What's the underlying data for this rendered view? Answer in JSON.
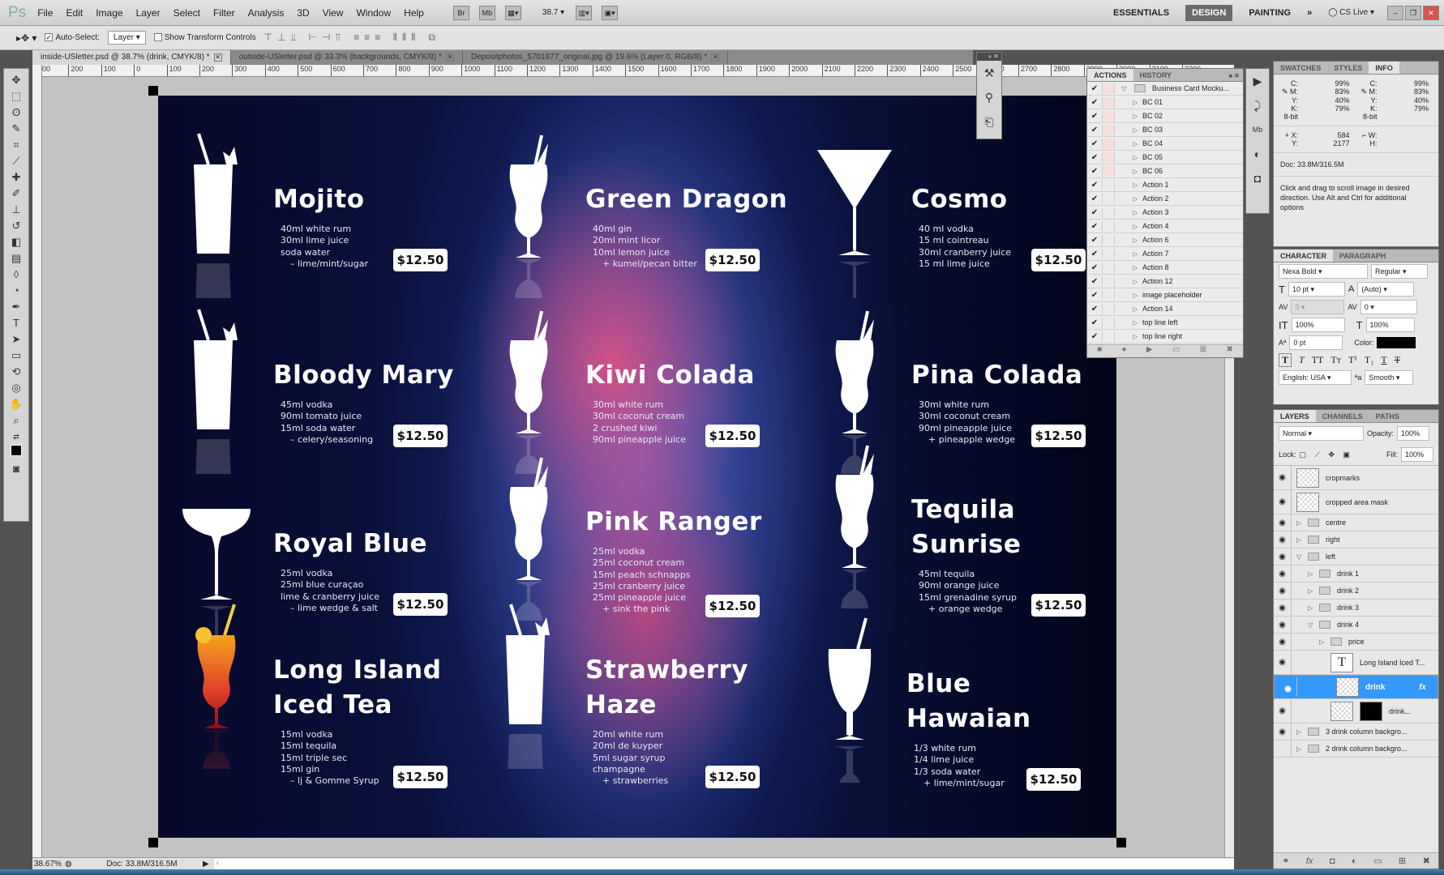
{
  "app": {
    "logo": "Ps",
    "menu": [
      "File",
      "Edit",
      "Image",
      "Layer",
      "Select",
      "Filter",
      "Analysis",
      "3D",
      "View",
      "Window",
      "Help"
    ],
    "bridge": "Br",
    "minibridge": "Mb",
    "zoom_select": "38.7",
    "workspaces": [
      "ESSENTIALS",
      "DESIGN",
      "PAINTING"
    ],
    "active_workspace": "DESIGN",
    "more": "»",
    "cs_live": "CS Live"
  },
  "options": {
    "auto_select_label": "Auto-Select:",
    "auto_select_checked": true,
    "auto_select_value": "Layer",
    "transform_label": "Show Transform Controls",
    "transform_checked": false
  },
  "tabs": [
    {
      "label": "inside-USletter.psd @ 38.7% (drink, CMYK/8) *",
      "active": true
    },
    {
      "label": "outside-USletter.psd @ 33.3% (backgrounds, CMYK/8) *",
      "active": false
    },
    {
      "label": "Depositphotos_5701877_original.jpg @ 19.6% (Layer 0, RGB/8) *",
      "active": false
    }
  ],
  "ruler": [
    "300",
    "200",
    "100",
    "0",
    "100",
    "200",
    "300",
    "400",
    "500",
    "600",
    "700",
    "800",
    "900",
    "1000",
    "1100",
    "1200",
    "1300",
    "1400",
    "1500",
    "1600",
    "1700",
    "1800",
    "1900",
    "2000",
    "2100",
    "2200",
    "2300",
    "2400",
    "2500",
    "2600",
    "2700",
    "2800",
    "2900",
    "3000",
    "3100",
    "3200"
  ],
  "status": {
    "zoom": "38.67%",
    "doc": "Doc: 33.8M/316.5M"
  },
  "menu_doc": {
    "drinks": [
      {
        "name": [
          "Mojito"
        ],
        "glass": "highball-glass-icon",
        "ingredients": [
          "40ml white rum",
          "30ml lime juice",
          "soda water"
        ],
        "garnish": "–  lime/mint/sugar",
        "price": "$12.50"
      },
      {
        "name": [
          "Bloody Mary"
        ],
        "glass": "highball-glass-icon",
        "ingredients": [
          "45ml vodka",
          "90ml tomato juice",
          "15ml soda water"
        ],
        "garnish": "–  celery/seasoning",
        "price": "$12.50"
      },
      {
        "name": [
          "Royal Blue"
        ],
        "glass": "margarita-glass-icon",
        "ingredients": [
          "25ml vodka",
          "25ml blue curaçao",
          "lime & cranberry juice"
        ],
        "garnish": "–  lime wedge & salt",
        "price": "$12.50"
      },
      {
        "name": [
          "Long Island",
          "Iced Tea"
        ],
        "glass": "hurricane-glass-colored-icon",
        "ingredients": [
          "15ml vodka",
          "15ml tequila",
          "15ml triple sec",
          "15ml gin"
        ],
        "garnish": "–  lj & Gomme Syrup",
        "price": "$12.50"
      },
      {
        "name": [
          "Green Dragon"
        ],
        "glass": "hurricane-glass-icon",
        "ingredients": [
          "40ml gin",
          "20ml mint licor",
          "10ml lemon juice"
        ],
        "garnish": "+  kumel/pecan bitter",
        "price": "$12.50"
      },
      {
        "name": [
          "Kiwi Colada"
        ],
        "glass": "hurricane-glass-icon",
        "ingredients": [
          "30ml white rum",
          "30ml coconut cream",
          "2 crushed kiwi",
          "90ml pineapple juice"
        ],
        "garnish": "",
        "price": "$12.50"
      },
      {
        "name": [
          "Pink Ranger"
        ],
        "glass": "hurricane-glass-icon",
        "ingredients": [
          "25ml vodka",
          "25ml coconut cream",
          "15ml peach schnapps",
          "25ml cranberry juice",
          "25ml pineapple juice"
        ],
        "garnish": "+  sink the pink",
        "price": "$12.50"
      },
      {
        "name": [
          "Strawberry",
          "Haze"
        ],
        "glass": "highball-glass-icon",
        "ingredients": [
          "20ml white rum",
          "20ml de kuyper",
          "5ml sugar syrup",
          "champagne"
        ],
        "garnish": "+  strawberries",
        "price": "$12.50"
      },
      {
        "name": [
          "Cosmo"
        ],
        "glass": "martini-glass-icon",
        "ingredients": [
          "40 ml vodka",
          "15 ml cointreau",
          "30ml cranberry juice",
          "15 ml lime juice"
        ],
        "garnish": "",
        "price": "$12.50"
      },
      {
        "name": [
          "Pina Colada"
        ],
        "glass": "hurricane-glass-icon",
        "ingredients": [
          "30ml white rum",
          "30ml coconut cream",
          "90ml pineapple juice"
        ],
        "garnish": "+  pineapple wedge",
        "price": "$12.50"
      },
      {
        "name": [
          "Tequila",
          "Sunrise"
        ],
        "glass": "hurricane-glass-icon",
        "ingredients": [
          "45ml tequila",
          "90ml orange juice",
          "15ml grenadine syrup"
        ],
        "garnish": "+  orange wedge",
        "price": "$12.50"
      },
      {
        "name": [
          "Blue",
          "Hawaian"
        ],
        "glass": "tulip-glass-icon",
        "ingredients": [
          "1/3 white rum",
          "1/4 lime juice",
          "1/3 soda water"
        ],
        "garnish": "+  lime/mint/sugar",
        "price": "$12.50"
      }
    ]
  },
  "actions_panel": {
    "tabs": [
      "ACTIONS",
      "HISTORY"
    ],
    "active_tab": "ACTIONS",
    "set": "Business Card Mocku...",
    "items": [
      "BC 01",
      "BC 02",
      "BC 03",
      "BC 04",
      "BC 05",
      "BC 06",
      "Action 1",
      "Action 2",
      "Action 3",
      "Action 4",
      "Action 6",
      "Action 7",
      "Action 8",
      "Action 12",
      "image placeholder",
      "Action 14",
      "top line left",
      "top line right"
    ]
  },
  "info_panel": {
    "tabs": [
      "SWATCHES",
      "STYLES",
      "INFO"
    ],
    "active_tab": "INFO",
    "left": {
      "C": "99%",
      "M": "83%",
      "Y": "40%",
      "K": "79%",
      "bits": "8-bit",
      "X": "584",
      "Y2": "2177"
    },
    "right": {
      "C": "99%",
      "M": "83%",
      "Y": "40%",
      "K": "79%",
      "bits": "8-bit",
      "W": "",
      "H": ""
    },
    "doc": "Doc: 33.8M/316.5M",
    "hint": "Click and drag to scroll image in desired direction.  Use Alt and Ctrl for additional options"
  },
  "character_panel": {
    "tabs": [
      "CHARACTER",
      "PARAGRAPH"
    ],
    "active_tab": "CHARACTER",
    "font": "Nexa Bold",
    "style": "Regular",
    "size": "10 pt",
    "leading": "(Auto)",
    "kerning": "0",
    "tracking": "0",
    "vscale": "100%",
    "hscale": "100%",
    "baseline": "0 pt",
    "color_label": "Color:",
    "color": "#000000",
    "language": "English: USA",
    "aa": "Smooth"
  },
  "layers_panel": {
    "tabs": [
      "LAYERS",
      "CHANNELS",
      "PATHS"
    ],
    "active_tab": "LAYERS",
    "blend": "Normal",
    "opacity_label": "Opacity:",
    "opacity": "100%",
    "lock_label": "Lock:",
    "fill_label": "Fill:",
    "fill": "100%",
    "layers": [
      {
        "name": "cropmarks",
        "kind": "smart",
        "depth": 0,
        "visible": true
      },
      {
        "name": "cropped area mask",
        "kind": "smart",
        "depth": 0,
        "visible": true
      },
      {
        "name": "centre",
        "kind": "group",
        "depth": 0,
        "visible": true,
        "open": false
      },
      {
        "name": "right",
        "kind": "group",
        "depth": 0,
        "visible": true,
        "open": false
      },
      {
        "name": "left",
        "kind": "group",
        "depth": 0,
        "visible": true,
        "open": true
      },
      {
        "name": "drink 1",
        "kind": "group",
        "depth": 1,
        "visible": true,
        "open": false
      },
      {
        "name": "drink 2",
        "kind": "group",
        "depth": 1,
        "visible": true,
        "open": false
      },
      {
        "name": "drink 3",
        "kind": "group",
        "depth": 1,
        "visible": true,
        "open": false
      },
      {
        "name": "drink 4",
        "kind": "group",
        "depth": 1,
        "visible": true,
        "open": true
      },
      {
        "name": "price",
        "kind": "group",
        "depth": 2,
        "visible": true,
        "open": false
      },
      {
        "name": "Long Island Iced T...",
        "kind": "text",
        "depth": 2,
        "visible": true
      },
      {
        "name": "drink",
        "kind": "smart",
        "depth": 2,
        "visible": true,
        "selected": true,
        "fx": "fx"
      },
      {
        "name": "drink...",
        "kind": "masked",
        "depth": 2,
        "visible": true
      },
      {
        "name": "3 drink column backgro...",
        "kind": "group",
        "depth": 0,
        "visible": true,
        "open": false
      },
      {
        "name": "2 drink column backgro...",
        "kind": "group",
        "depth": 0,
        "visible": false,
        "open": false
      }
    ]
  },
  "colors": {
    "selection": "#3399ff",
    "canvas": "#c3c3c3",
    "menu_bg": "#0b1545"
  }
}
